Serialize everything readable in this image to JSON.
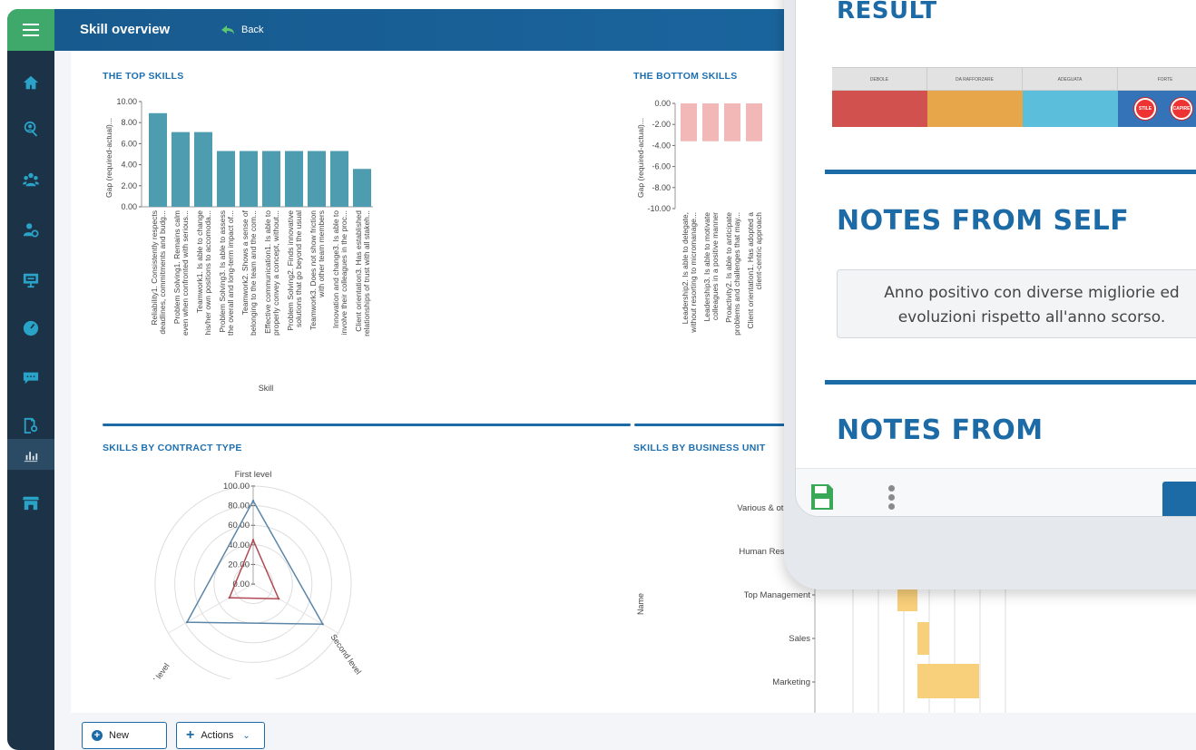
{
  "header": {
    "title": "Skill overview",
    "back_label": "Back"
  },
  "sidebar": {
    "items": [
      {
        "icon": "home-icon"
      },
      {
        "icon": "user-search-icon"
      },
      {
        "icon": "team-icon"
      },
      {
        "icon": "user-settings-icon"
      },
      {
        "icon": "presentation-icon"
      },
      {
        "icon": "gauge-icon"
      },
      {
        "icon": "chat-icon"
      },
      {
        "icon": "report-search-icon"
      },
      {
        "icon": "bar-chart-icon",
        "active": true
      },
      {
        "icon": "store-icon"
      }
    ],
    "accent": "#2aa3c8",
    "menu_color": "#3fa86b"
  },
  "panels": {
    "top": "THE TOP SKILLS",
    "bottom": "THE BOTTOM SKILLS",
    "contract": "SKILLS BY CONTRACT TYPE",
    "bu": "SKILLS BY BUSINESS UNIT"
  },
  "footer": {
    "new_label": "New",
    "actions_label": "Actions"
  },
  "phone": {
    "result_title": "RESULT",
    "result_headers": [
      "DEBOLE",
      "DA RAFFORZARE",
      "ADEGUATA",
      "FORTE"
    ],
    "result_colors": [
      "#d0514e",
      "#e8a64a",
      "#5bbfdc",
      "#3473b8"
    ],
    "stamps": [
      "STILE",
      "CAPIRE"
    ],
    "notes_self_title": "NOTES FROM SELF",
    "notes_self_text_line1": "Anno positivo con diverse migliorie ed",
    "notes_self_text_line2": "evoluzioni rispetto all'anno scorso.",
    "notes_from_title": "NOTES FROM"
  },
  "chart_data": [
    {
      "id": "top-skills",
      "type": "bar",
      "ylabel": "Gap (required-actual)...",
      "xlabel": "Skill",
      "ylim": [
        0,
        10
      ],
      "yticks": [
        "10.00",
        "8.00",
        "6.00",
        "4.00",
        "2.00",
        "0.00"
      ],
      "color": "#4e9cb0",
      "categories": [
        [
          "Reliability1. Consistently respects",
          "deadlines, commitments and budg..."
        ],
        [
          "Problem Solving1. Remains calm",
          "even when confronted with serious..."
        ],
        [
          "Teamwork1. Is able to change",
          "his/her own positions to accomoda..."
        ],
        [
          "Problem Solving3. Is able to assess",
          "the overall and long-term impact of..."
        ],
        [
          "Teamwork2. Shows a sense of",
          "belonging to the team and the com..."
        ],
        [
          "Effective communication1. Is able to",
          "properly convey a concept, without..."
        ],
        [
          "Problem Solving2. Finds innovative",
          "solutions that go beyond the usual"
        ],
        [
          "Teamwork3. Does not show friction",
          "with other team members"
        ],
        [
          "Innovation and change3. Is able to",
          "involve their colleagues in the proc..."
        ],
        [
          "Client orientation3. Has established",
          "relationships of trust with all stakeh..."
        ]
      ],
      "values": [
        8.9,
        7.1,
        7.1,
        5.3,
        5.3,
        5.3,
        5.3,
        5.3,
        5.3,
        3.6
      ]
    },
    {
      "id": "bottom-skills",
      "type": "bar",
      "ylabel": "Gap (required-actual)...",
      "ylim": [
        -10,
        0
      ],
      "yticks": [
        "0.00",
        "-2.00",
        "-4.00",
        "-6.00",
        "-8.00",
        "-10.00"
      ],
      "color": "#f2b8b8",
      "categories": [
        [
          "Leadership2. Is able to delegate,",
          "without resorting to micromanage..."
        ],
        [
          "Leadership3. Is able to motivate",
          "colleagues in a positive manner"
        ],
        [
          "Proactivity2. Is able to anticipate",
          "problems and challenges that may..."
        ],
        [
          "Client orientation1. Has adopted a",
          "client-centric approach"
        ]
      ],
      "values": [
        -3.6,
        -3.6,
        -3.6,
        -3.6
      ]
    },
    {
      "id": "contract-type",
      "type": "radar",
      "axes": [
        "First level",
        "Second level",
        "Third level"
      ],
      "rlim": [
        0,
        100
      ],
      "rticks": [
        "100.00",
        "80.00",
        "60.00",
        "40.00",
        "20.00",
        "0.00"
      ],
      "series": [
        {
          "values": [
            85,
            82,
            78
          ],
          "color": "#5b86a8"
        },
        {
          "values": [
            45,
            30,
            28
          ],
          "color": "#b04a55"
        }
      ]
    },
    {
      "id": "business-unit",
      "type": "bar",
      "orientation": "horizontal",
      "ylabel": "Name",
      "categories": [
        "Various & other BU",
        "Human Resources",
        "Top Management",
        "Sales",
        "Marketing"
      ],
      "color": "#f8cf7a"
    }
  ]
}
